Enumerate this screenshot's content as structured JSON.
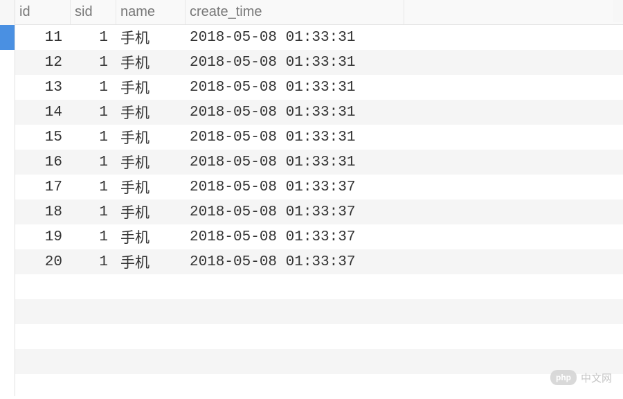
{
  "columns": {
    "id": "id",
    "sid": "sid",
    "name": "name",
    "create_time": "create_time"
  },
  "rows": [
    {
      "id": "11",
      "sid": "1",
      "name": "手机",
      "create_time": "2018-05-08 01:33:31"
    },
    {
      "id": "12",
      "sid": "1",
      "name": "手机",
      "create_time": "2018-05-08 01:33:31"
    },
    {
      "id": "13",
      "sid": "1",
      "name": "手机",
      "create_time": "2018-05-08 01:33:31"
    },
    {
      "id": "14",
      "sid": "1",
      "name": "手机",
      "create_time": "2018-05-08 01:33:31"
    },
    {
      "id": "15",
      "sid": "1",
      "name": "手机",
      "create_time": "2018-05-08 01:33:31"
    },
    {
      "id": "16",
      "sid": "1",
      "name": "手机",
      "create_time": "2018-05-08 01:33:31"
    },
    {
      "id": "17",
      "sid": "1",
      "name": "手机",
      "create_time": "2018-05-08 01:33:37"
    },
    {
      "id": "18",
      "sid": "1",
      "name": "手机",
      "create_time": "2018-05-08 01:33:37"
    },
    {
      "id": "19",
      "sid": "1",
      "name": "手机",
      "create_time": "2018-05-08 01:33:37"
    },
    {
      "id": "20",
      "sid": "1",
      "name": "手机",
      "create_time": "2018-05-08 01:33:37"
    }
  ],
  "watermark": {
    "badge": "php",
    "text": "中文网"
  }
}
